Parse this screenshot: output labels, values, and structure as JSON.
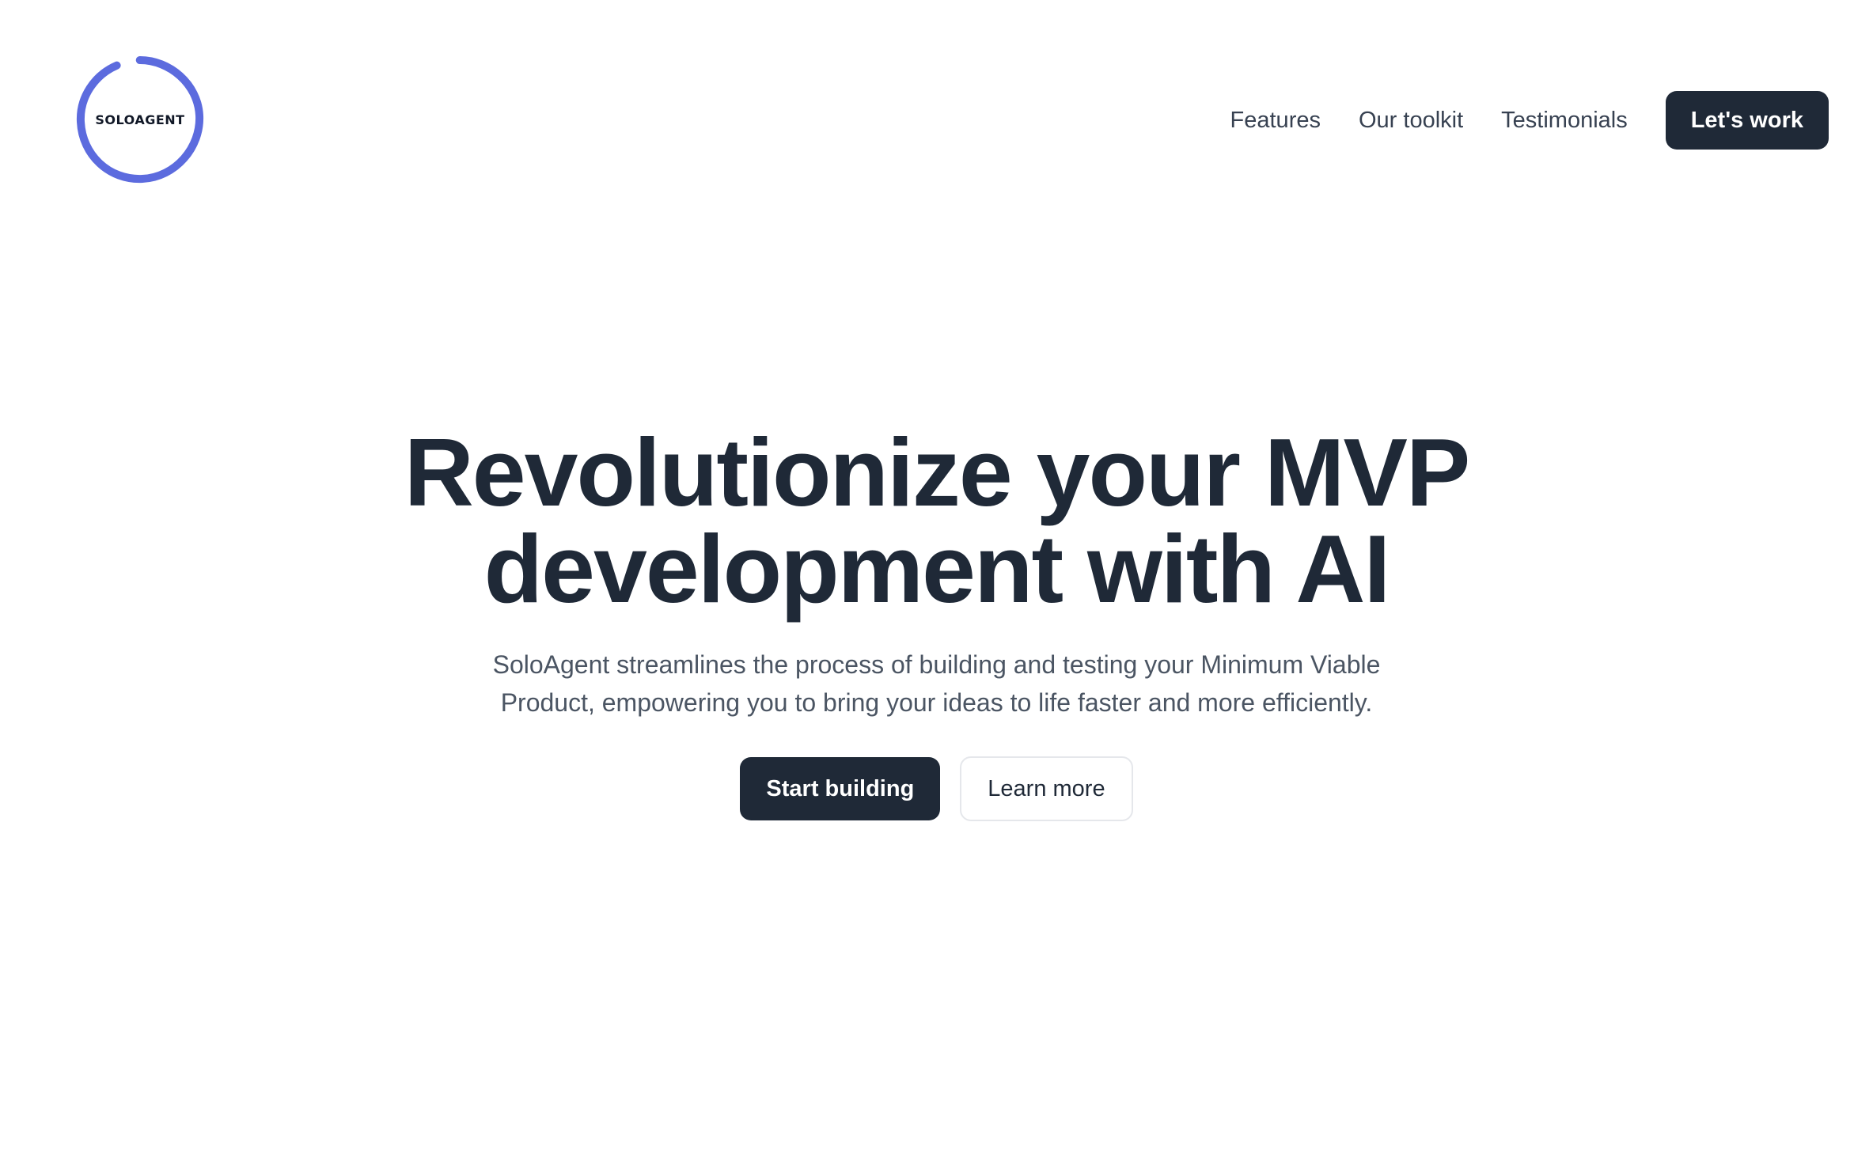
{
  "brand": {
    "logo_text": "SOLOAGENT",
    "logo_ring_color": "#5c6bde"
  },
  "nav": {
    "links": [
      "Features",
      "Our toolkit",
      "Testimonials"
    ],
    "cta_label": "Let's work"
  },
  "hero": {
    "title_lines": [
      "Revolutionize your MVP",
      "development with AI"
    ],
    "subtitle_lines": [
      "SoloAgent streamlines the process of building and testing your Minimum Viable",
      "Product, empowering you to bring your ideas to life faster and more efficiently."
    ],
    "primary_label": "Start building",
    "secondary_label": "Learn more"
  },
  "colors": {
    "text_dark": "#1f2937",
    "text_muted": "#4b5563",
    "button_dark": "#1f2937",
    "border_light": "#e5e7eb"
  }
}
